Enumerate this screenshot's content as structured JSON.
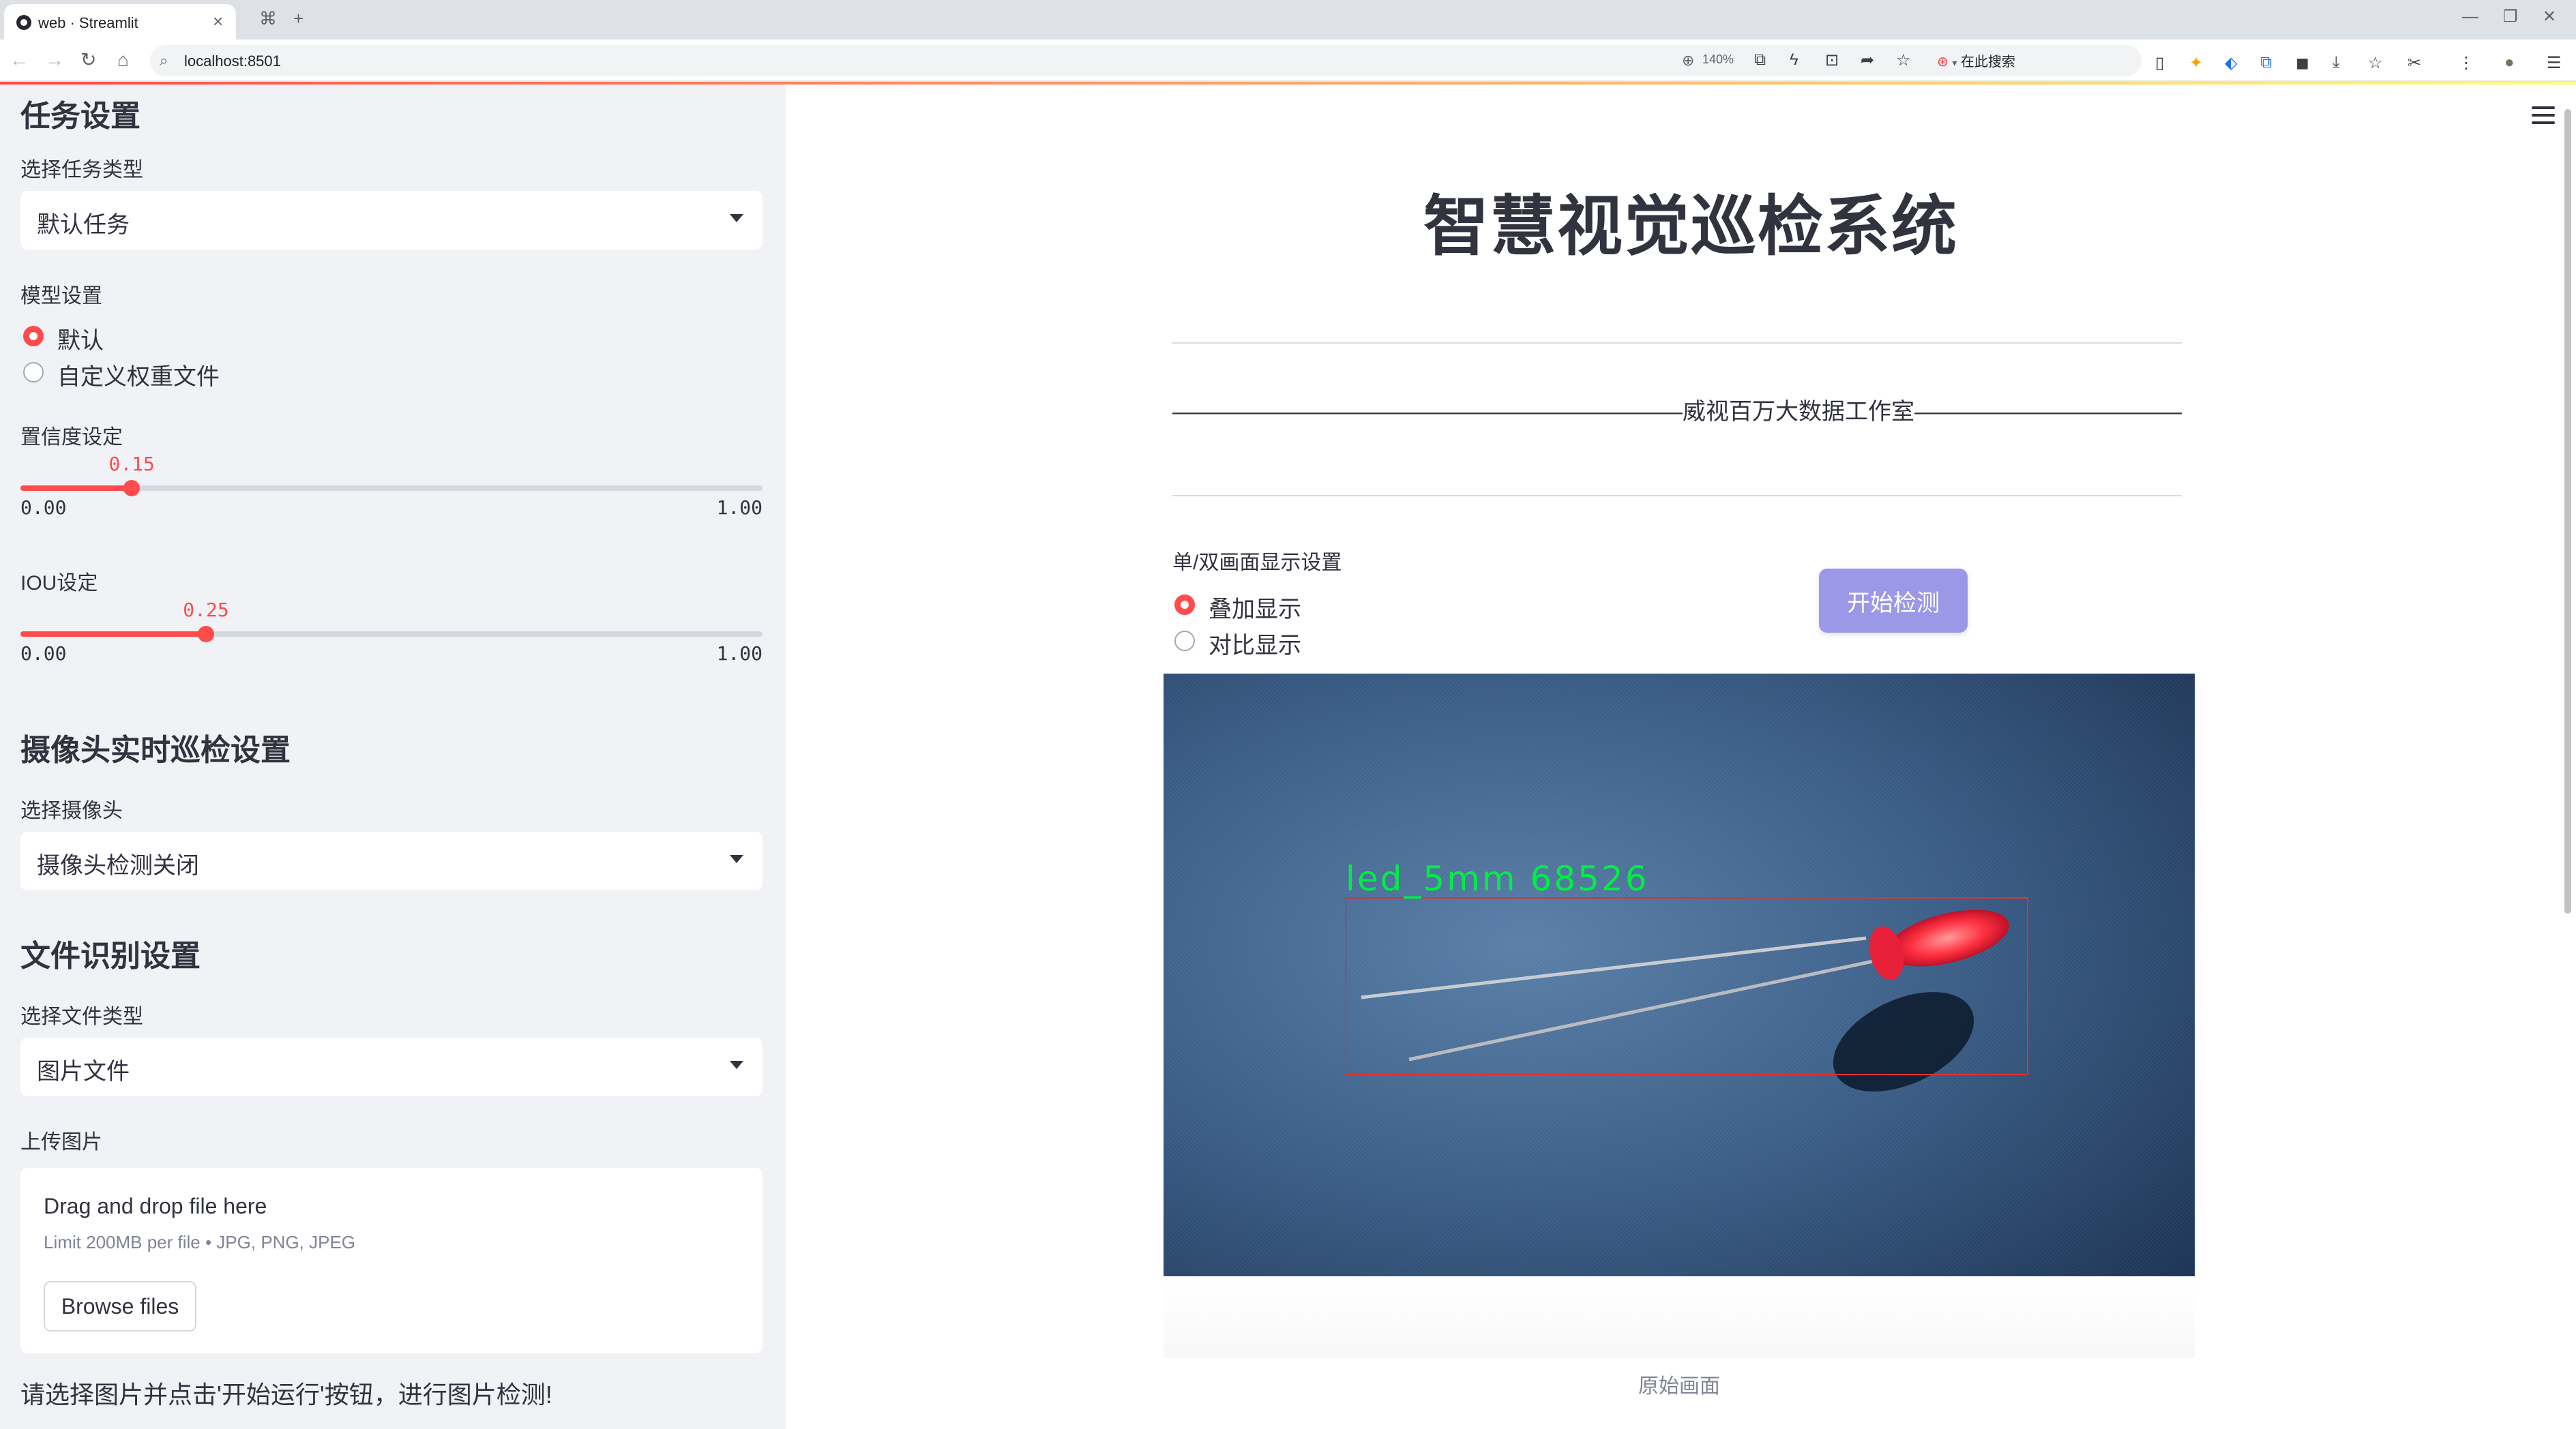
{
  "browser": {
    "tab_title": "web · Streamlit",
    "tab_close": "×",
    "new_tab": "+",
    "tab_search": "⌘",
    "url": "localhost:8501",
    "zoom": "140%",
    "search_engine_label": "在此搜索",
    "win_min": "—",
    "win_restore": "❐",
    "win_close": "✕"
  },
  "sidebar": {
    "task_heading": "任务设置",
    "task_type_label": "选择任务类型",
    "task_type_value": "默认任务",
    "model_label": "模型设置",
    "model_options": [
      "默认",
      "自定义权重文件"
    ],
    "model_selected": 0,
    "confidence_label": "置信度设定",
    "confidence": {
      "value": "0.15",
      "min": "0.00",
      "max": "1.00",
      "fraction": 0.15
    },
    "iou_label": "IOU设定",
    "iou": {
      "value": "0.25",
      "min": "0.00",
      "max": "1.00",
      "fraction": 0.25
    },
    "camera_heading": "摄像头实时巡检设置",
    "camera_label": "选择摄像头",
    "camera_value": "摄像头检测关闭",
    "file_heading": "文件识别设置",
    "file_type_label": "选择文件类型",
    "file_type_value": "图片文件",
    "upload_label": "上传图片",
    "dropzone_title": "Drag and drop file here",
    "dropzone_limit": "Limit 200MB per file • JPG, PNG, JPEG",
    "browse_label": "Browse files",
    "hint": "请选择图片并点击'开始运行'按钮，进行图片检测!"
  },
  "main": {
    "title": "智慧视觉巡检系统",
    "subtitle": "——————————————————————威视百万大数据工作室——————————————————————",
    "display_label": "单/双画面显示设置",
    "display_options": [
      "叠加显示",
      "对比显示"
    ],
    "display_selected": 0,
    "start_button": "开始检测",
    "detection_label": "led_5mm  68526",
    "caption": "原始画面"
  },
  "colors": {
    "accent": "#ff4b4b",
    "sidebar_bg": "#f0f2f6",
    "button_purple": "#9c98e8",
    "detection_green": "#00ee44",
    "detection_box": "#e03030"
  }
}
